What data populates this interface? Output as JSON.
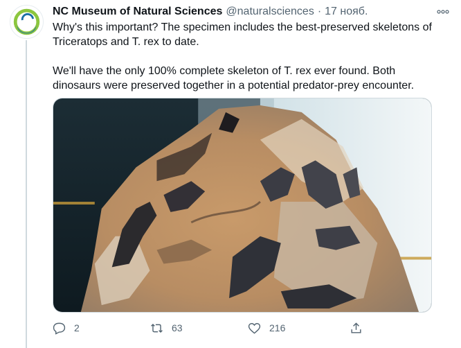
{
  "tweet": {
    "author_name": "NC Museum of Natural Sciences",
    "handle": "@naturalsciences",
    "separator": "·",
    "date": "17 нояб.",
    "paragraphs": [
      "Why's this important? The specimen includes the best-preserved skeletons of Triceratops and T. rex to date.",
      "We'll have the only 100% complete skeleton of T. rex ever found. Both dinosaurs were preserved together in a potential predator-prey encounter."
    ],
    "more_icon": "more-dots-icon",
    "media_icon": "photo-fossil-specimen"
  },
  "actions": {
    "reply_count": "2",
    "retweet_count": "63",
    "like_count": "216",
    "reply_icon": "reply-icon",
    "retweet_icon": "retweet-icon",
    "like_icon": "heart-icon",
    "share_icon": "share-icon"
  },
  "colors": {
    "text": "#0f1419",
    "secondary": "#536471",
    "border": "#cfd9de",
    "logo_green": "#8cc63f",
    "logo_blue": "#1a6fa6"
  }
}
